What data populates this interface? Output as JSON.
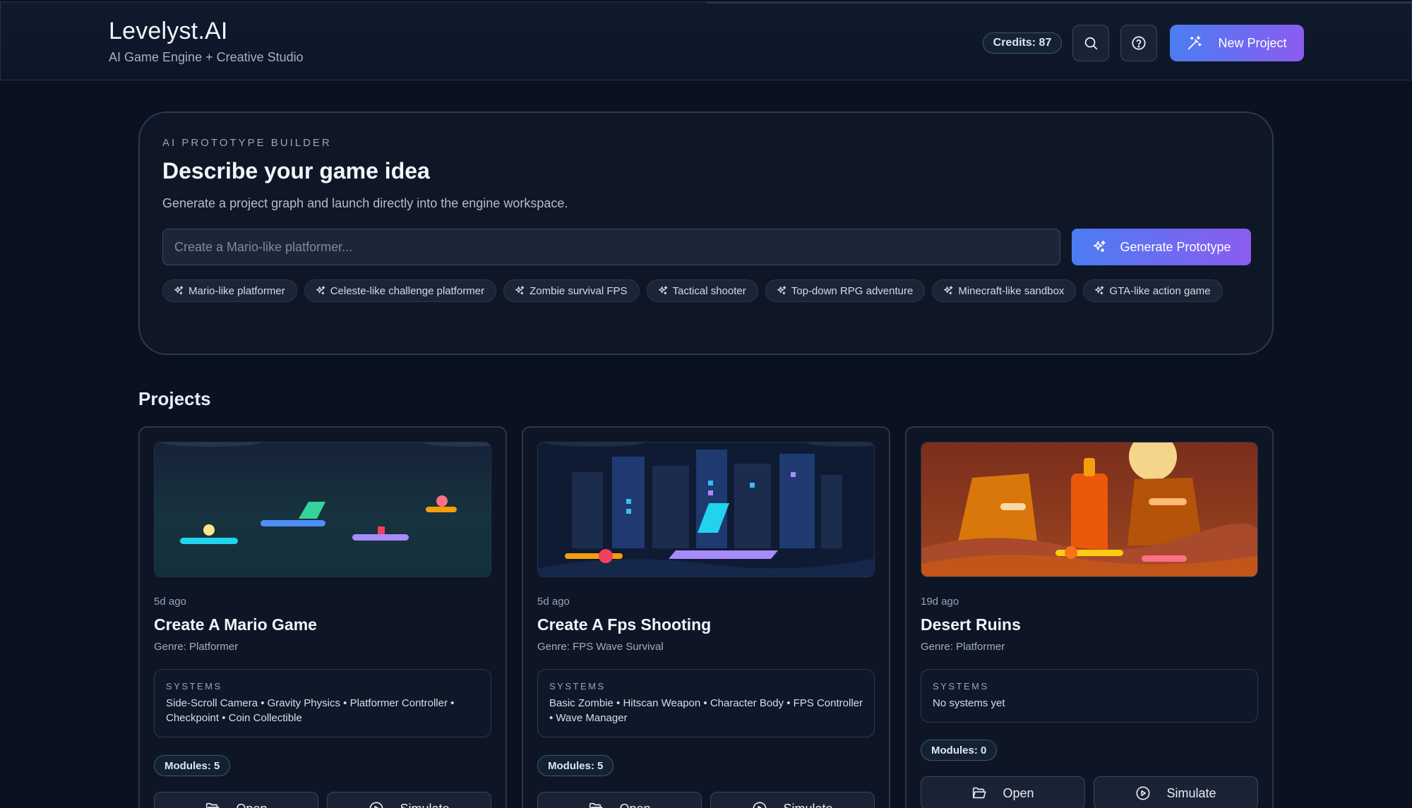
{
  "app": {
    "title": "Levelyst.AI",
    "subtitle": "AI Game Engine + Creative Studio",
    "credits": "Credits: 87",
    "new_project_label": "New Project"
  },
  "builder": {
    "eyebrow": "AI PROTOTYPE BUILDER",
    "title": "Describe your game idea",
    "description": "Generate a project graph and launch directly into the engine workspace.",
    "placeholder": "Create a Mario-like platformer...",
    "generate_label": "Generate Prototype",
    "chips": [
      "Mario-like platformer",
      "Celeste-like challenge platformer",
      "Zombie survival FPS",
      "Tactical shooter",
      "Top-down RPG adventure",
      "Minecraft-like sandbox",
      "GTA-like action game"
    ]
  },
  "projects": {
    "heading": "Projects",
    "systems_label": "SYSTEMS",
    "open_label": "Open",
    "simulate_label": "Simulate",
    "items": [
      {
        "time": "5d ago",
        "title": "Create A Mario Game",
        "genre": "Genre: Platformer",
        "systems": "Side-Scroll Camera • Gravity Physics • Platformer Controller • Checkpoint • Coin Collectible",
        "modules": "Modules: 5"
      },
      {
        "time": "5d ago",
        "title": "Create A Fps Shooting",
        "genre": "Genre: FPS Wave Survival",
        "systems": "Basic Zombie • Hitscan Weapon • Character Body • FPS Controller • Wave Manager",
        "modules": "Modules: 5"
      },
      {
        "time": "19d ago",
        "title": "Desert Ruins",
        "genre": "Genre: Platformer",
        "systems": "No systems yet",
        "modules": "Modules: 0"
      }
    ]
  },
  "colors": {
    "background": "#0a1120",
    "accent_start": "#4b7df2",
    "accent_end": "#8b5cf0"
  }
}
